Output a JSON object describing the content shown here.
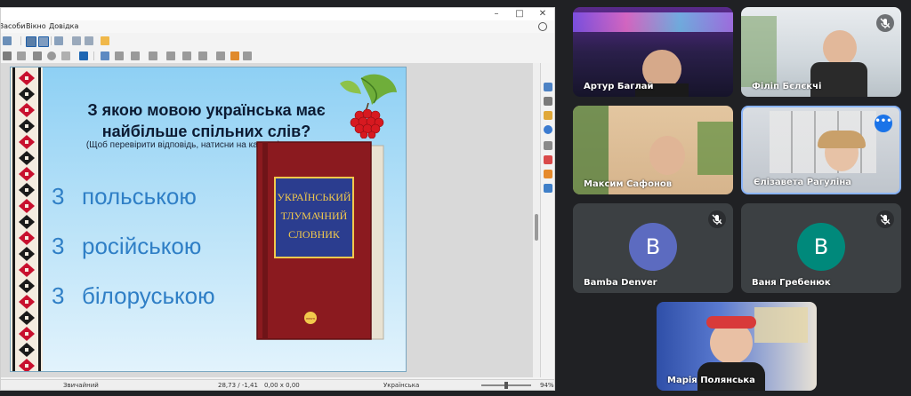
{
  "window": {
    "menu": [
      "Засоби",
      "Вікно",
      "Довідка"
    ]
  },
  "slide": {
    "question": "З якою мовою українська має найбільше спільних слів?",
    "hint": "(Щоб перевірити відповідь, натисни на калину)",
    "answers": [
      {
        "num": "3",
        "text": "польською"
      },
      {
        "num": "3",
        "text": "російською"
      },
      {
        "num": "3",
        "text": "білоруською"
      }
    ],
    "book": {
      "title_lines": [
        "УКРАЇНСЬКИЙ",
        "ТЛУМАЧНИЙ",
        "СЛОВНИК"
      ],
      "publisher": "ПЕРУН"
    }
  },
  "statusbar": {
    "layout": "Звичайний",
    "position": "28,73 / -1,41",
    "size": "0,00 x 0,00",
    "language": "Українська",
    "zoom": "94%"
  },
  "participants": [
    {
      "name": "Артур Баглай",
      "muted": false
    },
    {
      "name": "Філіп Бєлєкчі",
      "muted": true
    },
    {
      "name": "Максим Сафонов",
      "muted": false
    },
    {
      "name": "Єлізавета Рагуліна",
      "muted": false,
      "active": true
    },
    {
      "name": "Bamba Denver",
      "muted": true,
      "initial": "B",
      "avatar_color": "#5c6bc0"
    },
    {
      "name": "Ваня Гребенюк",
      "muted": true,
      "initial": "В",
      "avatar_color": "#00897b"
    },
    {
      "name": "Марія Полянська",
      "muted": false
    }
  ],
  "colors": {
    "meeting_bg": "#202124",
    "tile_bg": "#3c4043",
    "active_border": "#8ab4f8",
    "answer_text": "#2f7fc6",
    "book_cover": "#8b1a1f",
    "book_label": "#2b3d8f",
    "book_text": "#f2c94c"
  }
}
